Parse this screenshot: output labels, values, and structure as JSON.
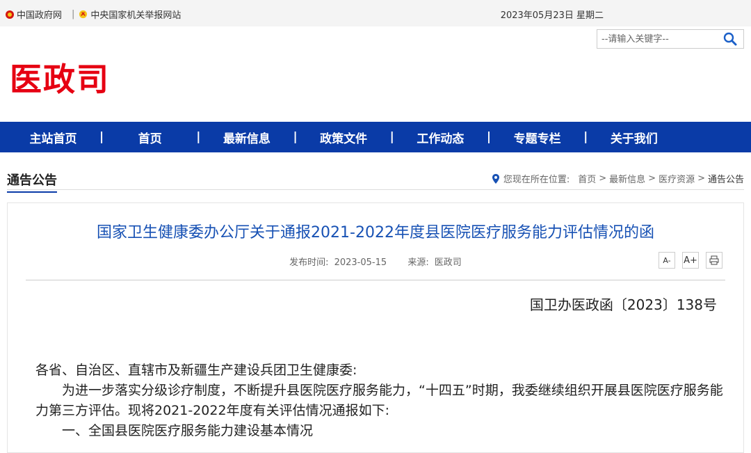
{
  "topbar": {
    "link1": "中国政府网",
    "link2": "中央国家机关举报网站",
    "separator": "|",
    "date": "2023年05月23日 星期二"
  },
  "search": {
    "placeholder": "--请输入关键字--"
  },
  "logo": "医政司",
  "nav": [
    {
      "label": "主站首页"
    },
    {
      "label": "首页"
    },
    {
      "label": "最新信息"
    },
    {
      "label": "政策文件"
    },
    {
      "label": "工作动态"
    },
    {
      "label": "专题专栏"
    },
    {
      "label": "关于我们"
    }
  ],
  "section": {
    "title": "通告公告",
    "crumbs_prefix": "您现在所在位置:",
    "crumbs": [
      "首页",
      "最新信息",
      "医疗资源",
      "通告公告"
    ]
  },
  "article": {
    "title": "国家卫生健康委办公厅关于通报2021-2022年度县医院医疗服务能力评估情况的函",
    "publish_label": "发布时间:",
    "publish_date": "2023-05-15",
    "source_label": "来源:",
    "source": "医政司",
    "tools": {
      "smaller": "A-",
      "larger": "A+",
      "print": "print-icon"
    },
    "doc_number": "国卫办医政函〔2023〕138号",
    "salutation": "各省、自治区、直辖市及新疆生产建设兵团卫生健康委:",
    "para1": "为进一步落实分级诊疗制度，不断提升县医院医疗服务能力，“十四五”时期，我委继续组织开展县医院医疗服务能力第三方评估。现将2021-2022年度有关评估情况通报如下:",
    "heading1": "一、全国县医院医疗服务能力建设基本情况"
  },
  "colors": {
    "nav_bg": "#0a3ba7",
    "logo": "#e60012",
    "title": "#1751b4"
  }
}
